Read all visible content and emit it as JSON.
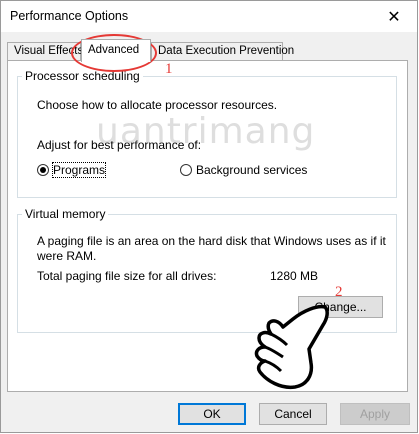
{
  "window": {
    "title": "Performance Options",
    "close_glyph": "✕"
  },
  "tabs": [
    {
      "label": "Visual Effects",
      "active": false
    },
    {
      "label": "Advanced",
      "active": true
    },
    {
      "label": "Data Execution Prevention",
      "active": false
    }
  ],
  "processor": {
    "legend": "Processor scheduling",
    "description": "Choose how to allocate processor resources.",
    "adjust_label": "Adjust for best performance of:",
    "options": [
      {
        "label": "Programs",
        "checked": true
      },
      {
        "label": "Background services",
        "checked": false
      }
    ]
  },
  "virtual_memory": {
    "legend": "Virtual memory",
    "description_line1": "A paging file is an area on the hard disk that Windows uses as if it",
    "description_line2": "were RAM.",
    "total_label": "Total paging file size for all drives:",
    "total_value": "1280 MB",
    "change_button": "Change..."
  },
  "buttons": {
    "ok": "OK",
    "cancel": "Cancel",
    "apply": "Apply"
  },
  "annotations": {
    "step1": "1",
    "step2": "2",
    "color": "#e53935"
  },
  "watermark": "uantrimang"
}
